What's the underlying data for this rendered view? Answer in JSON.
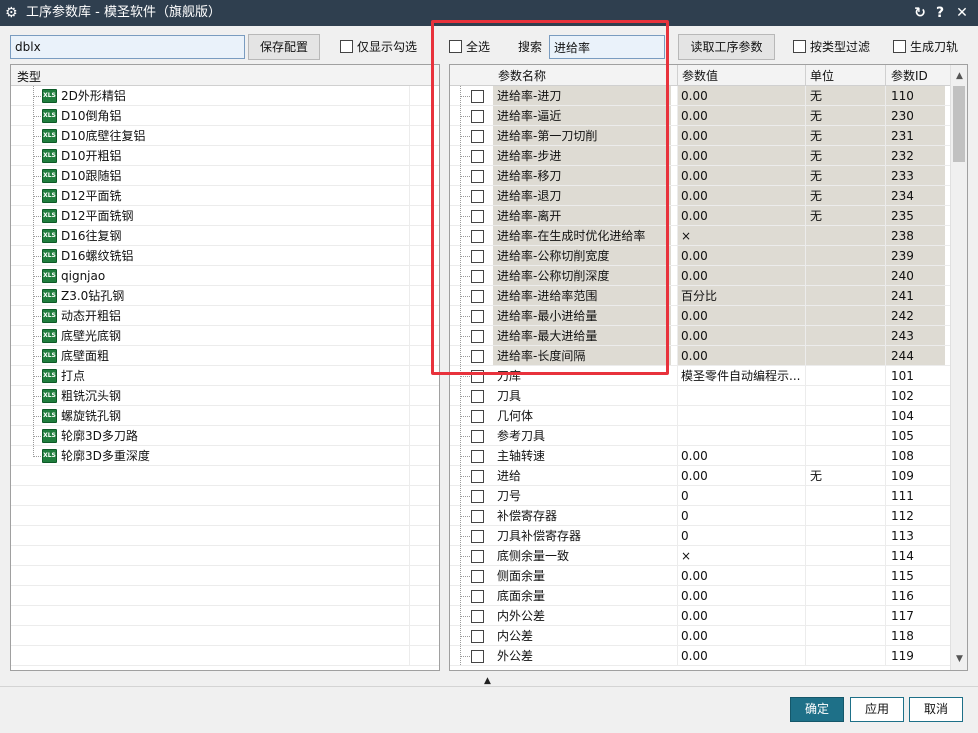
{
  "window": {
    "title": "工序参数库 - 模圣软件（旗舰版）",
    "title_icon": "gear-icon",
    "buttons": {
      "refresh": "↻",
      "help": "?",
      "close": "✕"
    },
    "title_bar_color": "#2f3f4f"
  },
  "left_toolbar": {
    "filter_value": "dblx",
    "save_config_label": "保存配置",
    "show_checked_only_label": "仅显示勾选"
  },
  "right_toolbar": {
    "select_all_label": "全选",
    "search_label": "搜索",
    "search_value": "进给率",
    "read_params_label": "读取工序参数",
    "filter_by_type_label": "按类型过滤",
    "generate_toolpath_label": "生成刀轨"
  },
  "left_panel": {
    "column_header": "类型",
    "item_icon": "xls-file-icon",
    "items": [
      {
        "label": "2D外形精铝"
      },
      {
        "label": "D10倒角铝"
      },
      {
        "label": "D10底壁往复铝"
      },
      {
        "label": "D10开粗铝"
      },
      {
        "label": "D10跟随铝"
      },
      {
        "label": "D12平面铣"
      },
      {
        "label": "D12平面铣钢"
      },
      {
        "label": "D16往复钢"
      },
      {
        "label": "D16螺纹铣铝"
      },
      {
        "label": "qignjao"
      },
      {
        "label": "Z3.0钻孔钢"
      },
      {
        "label": "动态开粗铝"
      },
      {
        "label": "底壁光底钢"
      },
      {
        "label": "底壁面粗"
      },
      {
        "label": "打点"
      },
      {
        "label": "粗铣沉头钢"
      },
      {
        "label": "螺旋铣孔钢"
      },
      {
        "label": "轮廓3D多刀路"
      },
      {
        "label": "轮廓3D多重深度"
      }
    ]
  },
  "param_table": {
    "columns": [
      "参数名称",
      "参数值",
      "单位",
      "参数ID"
    ],
    "highlight_color": "#dedbd3",
    "rows": [
      {
        "name": "进给率-进刀",
        "value": "0.00",
        "unit": "无",
        "id": "110",
        "highlighted": true
      },
      {
        "name": "进给率-逼近",
        "value": "0.00",
        "unit": "无",
        "id": "230",
        "highlighted": true
      },
      {
        "name": "进给率-第一刀切削",
        "value": "0.00",
        "unit": "无",
        "id": "231",
        "highlighted": true
      },
      {
        "name": "进给率-步进",
        "value": "0.00",
        "unit": "无",
        "id": "232",
        "highlighted": true
      },
      {
        "name": "进给率-移刀",
        "value": "0.00",
        "unit": "无",
        "id": "233",
        "highlighted": true
      },
      {
        "name": "进给率-退刀",
        "value": "0.00",
        "unit": "无",
        "id": "234",
        "highlighted": true
      },
      {
        "name": "进给率-离开",
        "value": "0.00",
        "unit": "无",
        "id": "235",
        "highlighted": true
      },
      {
        "name": "进给率-在生成时优化进给率",
        "value": "×",
        "unit": "",
        "id": "238",
        "highlighted": true
      },
      {
        "name": "进给率-公称切削宽度",
        "value": "0.00",
        "unit": "",
        "id": "239",
        "highlighted": true
      },
      {
        "name": "进给率-公称切削深度",
        "value": "0.00",
        "unit": "",
        "id": "240",
        "highlighted": true
      },
      {
        "name": "进给率-进给率范围",
        "value": "百分比",
        "unit": "",
        "id": "241",
        "highlighted": true
      },
      {
        "name": "进给率-最小进给量",
        "value": "0.00",
        "unit": "",
        "id": "242",
        "highlighted": true
      },
      {
        "name": "进给率-最大进给量",
        "value": "0.00",
        "unit": "",
        "id": "243",
        "highlighted": true
      },
      {
        "name": "进给率-长度间隔",
        "value": "0.00",
        "unit": "",
        "id": "244",
        "highlighted": true
      },
      {
        "name": "刀库",
        "value": "模圣零件自动编程示...",
        "unit": "",
        "id": "101",
        "highlighted": false
      },
      {
        "name": "刀具",
        "value": "",
        "unit": "",
        "id": "102",
        "highlighted": false
      },
      {
        "name": "几何体",
        "value": "",
        "unit": "",
        "id": "104",
        "highlighted": false
      },
      {
        "name": "参考刀具",
        "value": "",
        "unit": "",
        "id": "105",
        "highlighted": false
      },
      {
        "name": "主轴转速",
        "value": "0.00",
        "unit": "",
        "id": "108",
        "highlighted": false
      },
      {
        "name": "进给",
        "value": "0.00",
        "unit": "无",
        "id": "109",
        "highlighted": false
      },
      {
        "name": "刀号",
        "value": "0",
        "unit": "",
        "id": "111",
        "highlighted": false
      },
      {
        "name": "补偿寄存器",
        "value": "0",
        "unit": "",
        "id": "112",
        "highlighted": false
      },
      {
        "name": "刀具补偿寄存器",
        "value": "0",
        "unit": "",
        "id": "113",
        "highlighted": false
      },
      {
        "name": "底侧余量一致",
        "value": "×",
        "unit": "",
        "id": "114",
        "highlighted": false
      },
      {
        "name": "侧面余量",
        "value": "0.00",
        "unit": "",
        "id": "115",
        "highlighted": false
      },
      {
        "name": "底面余量",
        "value": "0.00",
        "unit": "",
        "id": "116",
        "highlighted": false
      },
      {
        "name": "内外公差",
        "value": "0.00",
        "unit": "",
        "id": "117",
        "highlighted": false
      },
      {
        "name": "内公差",
        "value": "0.00",
        "unit": "",
        "id": "118",
        "highlighted": false
      },
      {
        "name": "外公差",
        "value": "0.00",
        "unit": "",
        "id": "119",
        "highlighted": false
      }
    ]
  },
  "footer": {
    "ok_label": "确定",
    "apply_label": "应用",
    "cancel_label": "取消",
    "ok_color": "#1e7088"
  },
  "annotation_color": "#e8323c"
}
